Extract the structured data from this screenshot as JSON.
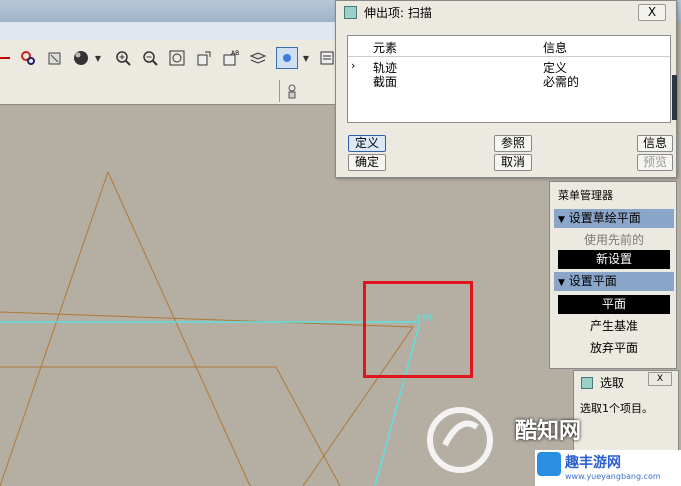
{
  "dialog": {
    "title": "伸出项: 扫描",
    "close": "X",
    "columns": {
      "element": "元素",
      "info": "信息"
    },
    "rows": [
      {
        "element": "轨迹",
        "info": "定义"
      },
      {
        "element": "截面",
        "info": "必需的"
      }
    ],
    "buttons": {
      "define": "定义",
      "reference": "参照",
      "info": "信息",
      "ok": "确定",
      "cancel": "取消",
      "preview": "预览"
    }
  },
  "menu_manager": {
    "title": "菜单管理器",
    "sections": [
      {
        "header": "设置草绘平面",
        "items": [
          "使用先前的",
          "新设置"
        ]
      },
      {
        "header": "设置平面",
        "items": [
          "平面",
          "产生基准",
          "放弃平面"
        ]
      }
    ]
  },
  "select_dialog": {
    "title": "选取",
    "hint": "选取1个项目。"
  },
  "canvas": {
    "label": "PRT"
  },
  "watermark": {
    "brand": "酷知网",
    "brand2": "趣丰游网",
    "url": "www.yueyangbang.com"
  },
  "colors": {
    "canvas_bg": "#b4aea3",
    "sketch_line": "#b07838",
    "datum_line": "#5fe0e0",
    "highlight": "#e0141c",
    "menu_header": "#8aa6c8"
  }
}
